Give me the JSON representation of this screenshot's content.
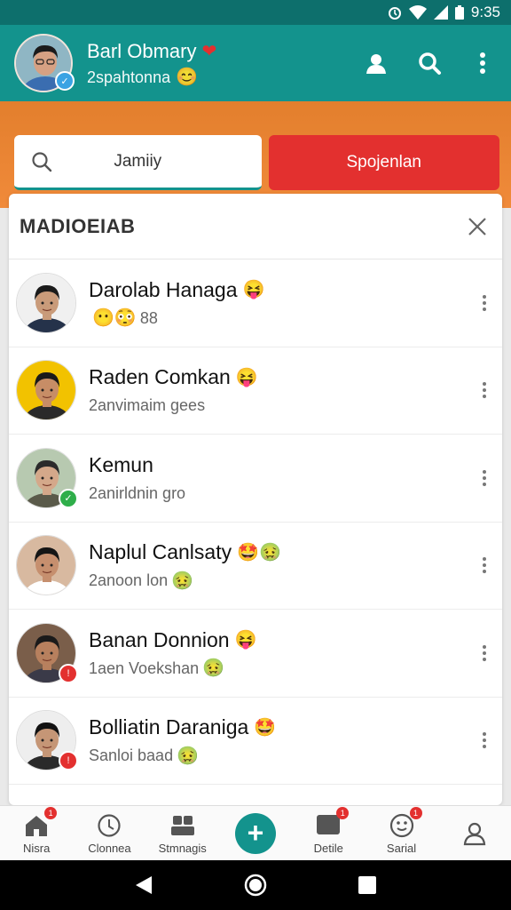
{
  "status_bar": {
    "time": "9:35",
    "icons": [
      "alarm-icon",
      "wifi-icon",
      "signal-icon",
      "battery-icon"
    ]
  },
  "header": {
    "name": "Barl Obmary",
    "subtitle": "2spahtonna",
    "name_emoji": "❤",
    "subtitle_emoji": "😊",
    "actions": [
      "profile-icon",
      "search-icon",
      "more-vert-icon"
    ]
  },
  "tabs": {
    "search_label": "Jamiiy",
    "second_label": "Spojenlan"
  },
  "panel": {
    "title": "MADIOEIAB"
  },
  "contacts": [
    {
      "name": "Darolab Hanaga",
      "name_emoji": "😝",
      "sub": "",
      "sub_emoji": "😶😳",
      "sub_tail": "88",
      "skin": "#c99b7a",
      "hair": "#1b1b1b",
      "shirt": "#25324a",
      "bg": "#f0f0f0",
      "badge": ""
    },
    {
      "name": "Raden Comkan",
      "name_emoji": "😝",
      "sub": "2anvimaim gees",
      "sub_emoji": "",
      "sub_tail": "",
      "skin": "#c78d66",
      "hair": "#1a1a1a",
      "shirt": "#2a2a2a",
      "bg": "#f2c200",
      "badge": ""
    },
    {
      "name": "Kemun",
      "name_emoji": "",
      "sub": "2anirldnin gro",
      "sub_emoji": "",
      "sub_tail": "",
      "skin": "#d4a88a",
      "hair": "#2b2b2b",
      "shirt": "#5a5a4a",
      "bg": "#b7c9b0",
      "badge": "green"
    },
    {
      "name": "Naplul Canlsaty",
      "name_emoji": "🤩🤢",
      "sub": "2anoon lon",
      "sub_emoji": "🤢",
      "sub_tail": "",
      "skin": "#c68f6e",
      "hair": "#151515",
      "shirt": "#ffffff",
      "bg": "#d8b9a0",
      "badge": ""
    },
    {
      "name": "Banan Donnion",
      "name_emoji": "😝",
      "sub": "1aen Voekshan",
      "sub_emoji": "🤢",
      "sub_tail": "",
      "skin": "#b7805e",
      "hair": "#1a1a1a",
      "shirt": "#3a3a48",
      "bg": "#7a5e4a",
      "badge": "red"
    },
    {
      "name": "Bolliatin Daraniga",
      "name_emoji": "🤩",
      "sub": "Sanloi baad",
      "sub_emoji": "🤢",
      "sub_tail": "",
      "skin": "#c59676",
      "hair": "#121212",
      "shirt": "#2a2a2a",
      "bg": "#eeeeee",
      "badge": "red"
    }
  ],
  "bottom_nav": [
    {
      "label": "Nisra",
      "icon": "home-icon",
      "badge": "1"
    },
    {
      "label": "Clonnea",
      "icon": "clock-icon",
      "badge": ""
    },
    {
      "label": "Stmnagis",
      "icon": "people-icon",
      "badge": ""
    },
    {
      "label": "",
      "icon": "add-icon",
      "badge": ""
    },
    {
      "label": "Detile",
      "icon": "chat-icon",
      "badge": "1"
    },
    {
      "label": "Sarial",
      "icon": "smiley-icon",
      "badge": "1"
    },
    {
      "label": "",
      "icon": "person-icon",
      "badge": ""
    }
  ],
  "colors": {
    "teal": "#13938d",
    "teal_dark": "#0d6f6c",
    "orange": "#e37f2d",
    "red": "#e3302f"
  }
}
